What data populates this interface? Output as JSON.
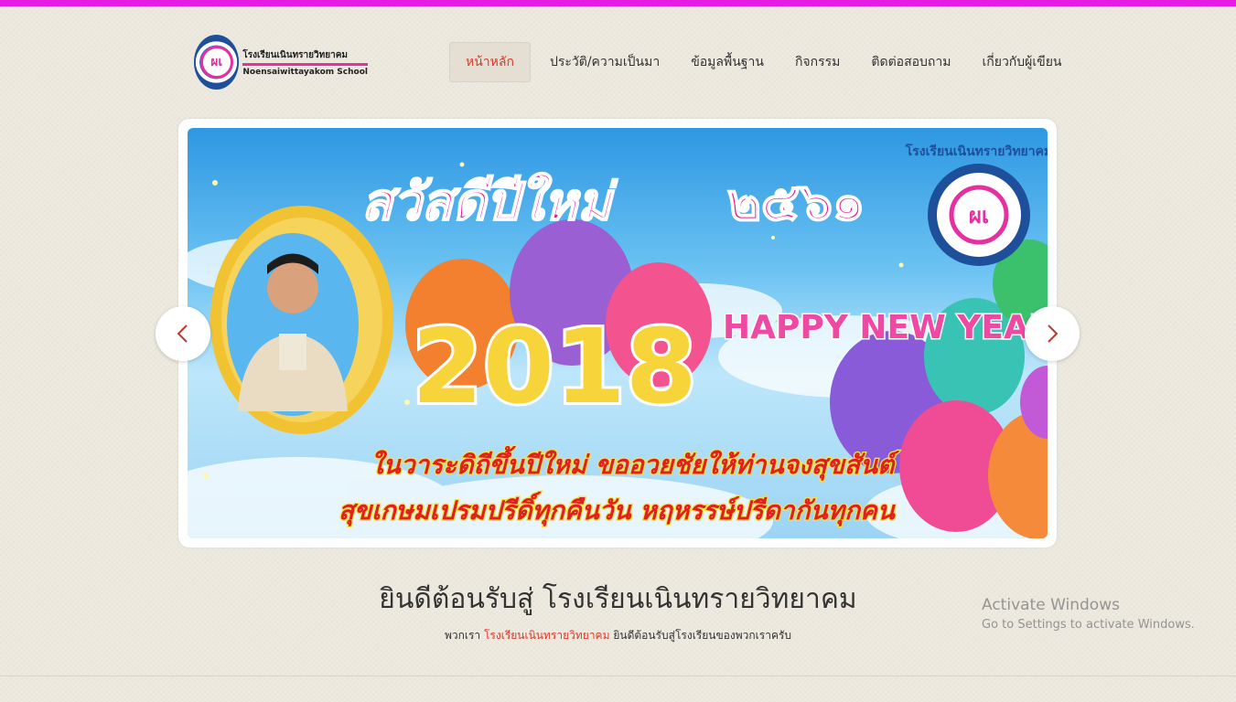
{
  "header": {
    "logo_emblem": "ผเ",
    "logo_name_th": "โรงเรียนเนินทรายวิทยาคม",
    "logo_name_en": "Noensaiwittayakom School"
  },
  "nav": {
    "items": [
      {
        "label": "หน้าหลัก",
        "active": true
      },
      {
        "label": "ประวัติ/ความเป็นมา",
        "active": false
      },
      {
        "label": "ข้อมูลพื้นฐาน",
        "active": false
      },
      {
        "label": "กิจกรรม",
        "active": false
      },
      {
        "label": "ติดต่อสอบถาม",
        "active": false
      },
      {
        "label": "เกี่ยวกับผู้เขียน",
        "active": false
      }
    ]
  },
  "slider": {
    "slide": {
      "greeting_th": "สวัสดีปีใหม่",
      "year_th": "๒๕๖๑",
      "year": "2018",
      "happy_new_year": "HAPPY NEW YEAR",
      "wish_line_1": "ในวาระดิถีขึ้นปีใหม่  ขออวยชัยให้ท่านจงสุขสันต์",
      "wish_line_2": "สุขเกษมเปรมปรีดิ์ทุกคืนวัน  หฤหรรษ์ปรีดากันทุกคน",
      "seal_text": "โรงเรียนเนินทรายวิทยาคม",
      "seal_emblem": "ผเ"
    },
    "prev_icon": "chevron-left-icon",
    "next_icon": "chevron-right-icon"
  },
  "welcome": {
    "title": "ยินดีต้อนรับสู่ โรงเรียนเนินทรายวิทยาคม",
    "sub_prefix": "พวกเรา",
    "sub_highlight": "โรงเรียนเนินทรายวิทยาคม",
    "sub_suffix": "ยินดีต้อนรับสู่โรงเรียนของพวกเราครับ"
  },
  "watermark": {
    "title": "Activate Windows",
    "subtitle": "Go to Settings to activate Windows."
  },
  "colors": {
    "accent_top_bar": "#e61ce3",
    "active_link": "#d93a2b",
    "background": "#ece8dd"
  }
}
